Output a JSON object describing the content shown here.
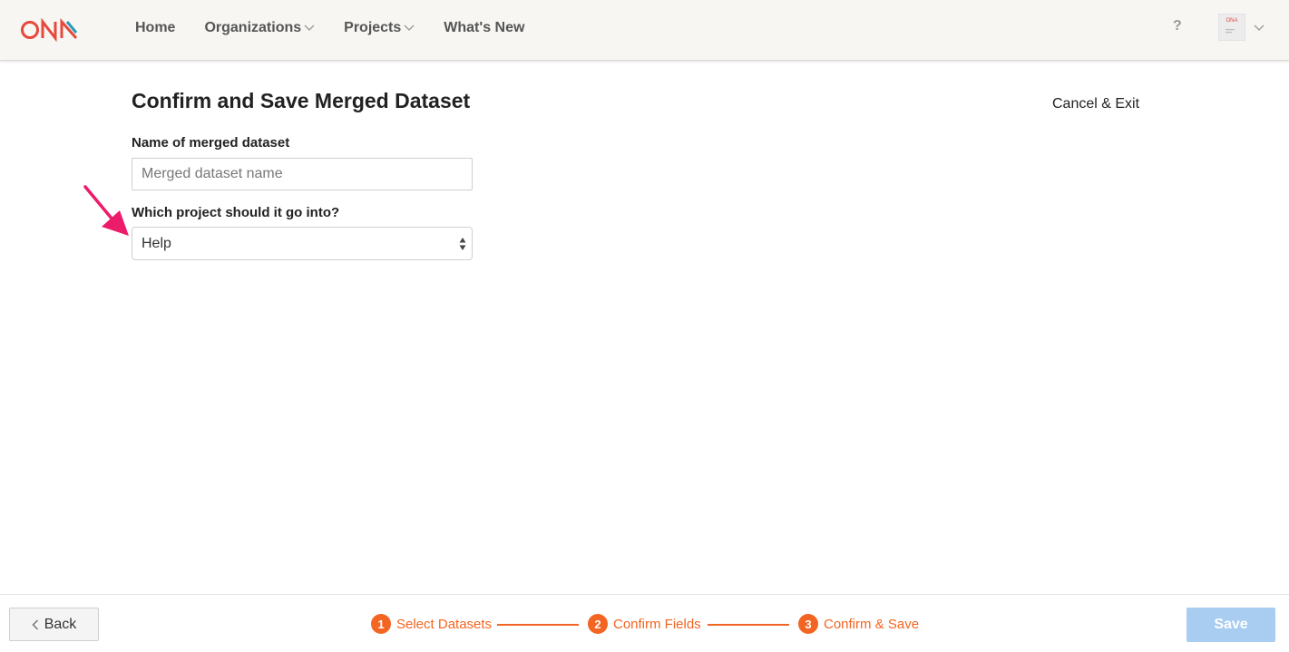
{
  "header": {
    "logo_text": "ONA",
    "nav": [
      {
        "label": "Home",
        "has_dropdown": false
      },
      {
        "label": "Organizations",
        "has_dropdown": true
      },
      {
        "label": "Projects",
        "has_dropdown": true
      },
      {
        "label": "What's New",
        "has_dropdown": false
      }
    ],
    "help_label": "?"
  },
  "main": {
    "title": "Confirm and Save Merged Dataset",
    "cancel_label": "Cancel & Exit",
    "name_label": "Name of merged dataset",
    "name_placeholder": "Merged dataset name",
    "name_value": "",
    "project_label": "Which project should it go into?",
    "project_selected": "Help"
  },
  "footer": {
    "back_label": "Back",
    "steps": [
      {
        "number": "1",
        "label": "Select Datasets"
      },
      {
        "number": "2",
        "label": "Confirm Fields"
      },
      {
        "number": "3",
        "label": "Confirm & Save"
      }
    ],
    "save_label": "Save"
  },
  "colors": {
    "accent_orange": "#f26522",
    "annotation_pink": "#ec1c6a",
    "save_disabled": "#a8cdf0",
    "logo_red": "#e8483b",
    "logo_teal": "#2a9bb5"
  },
  "icons": {
    "nav_dropdown": "chevron-down-icon",
    "select_toggle": "up-down-arrows-icon",
    "back": "chevron-left-icon",
    "annotation": "pointer-arrow-icon"
  }
}
